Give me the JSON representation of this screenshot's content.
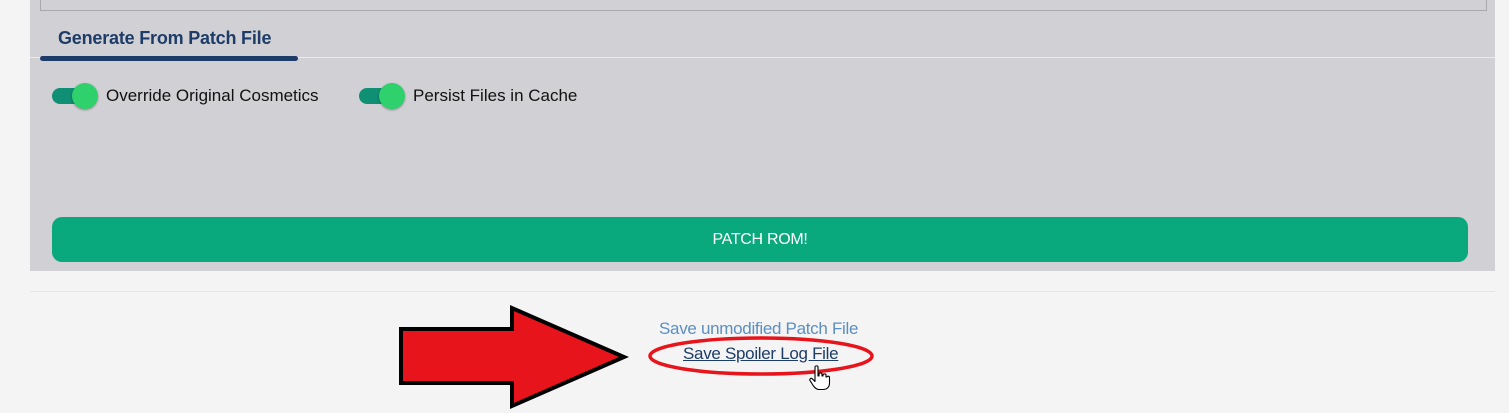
{
  "tab": {
    "label": "Generate From Patch File"
  },
  "toggles": [
    {
      "label": "Override Original Cosmetics",
      "on": true
    },
    {
      "label": "Persist Files in Cache",
      "on": true
    }
  ],
  "patch_button": {
    "label": "PATCH ROM!"
  },
  "links": {
    "unmodified_patch": "Save unmodified Patch File",
    "spoiler_log": "Save Spoiler Log File"
  },
  "colors": {
    "accent": "#0aa87d",
    "toggle_knob": "#2fd16c",
    "tab_text": "#1d3c68",
    "annotation_red": "#e8141c"
  }
}
